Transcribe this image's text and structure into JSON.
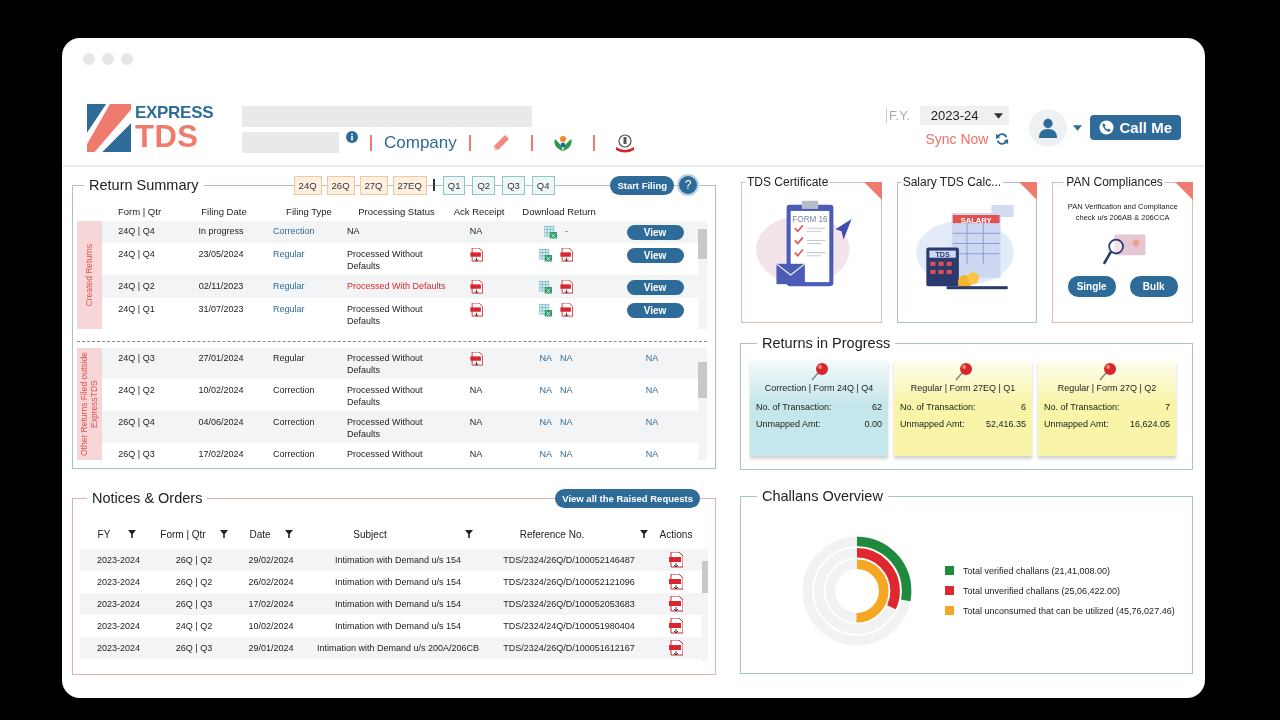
{
  "header": {
    "logo": {
      "top": "EXPRESS",
      "bottom": "TDS"
    },
    "company_link": "Company",
    "fy": {
      "label": "F.Y.",
      "value": "2023-24"
    },
    "sync": "Sync Now",
    "call": "Call Me"
  },
  "return_summary": {
    "title": "Return Summary",
    "forms": [
      {
        "label": "24Q",
        "selected": false
      },
      {
        "label": "26Q",
        "selected": false
      },
      {
        "label": "27Q",
        "selected": false
      },
      {
        "label": "27EQ",
        "selected": false
      }
    ],
    "quarters": [
      {
        "label": "Q1",
        "selected": false
      },
      {
        "label": "Q2",
        "selected": false
      },
      {
        "label": "Q3",
        "selected": false
      },
      {
        "label": "Q4",
        "selected": false
      }
    ],
    "start": "Start Filing",
    "help": "?",
    "columns": [
      "Form | Qtr",
      "Filing Date",
      "Filing Type",
      "Processing Status",
      "Ack Receipt",
      "Download Return"
    ],
    "groups": [
      {
        "kind": "created",
        "label": "Created Returns",
        "rows": [
          {
            "form": "24Q | Q4",
            "date": "In progress",
            "type": "Correction",
            "status": "NA",
            "alert": false,
            "ack": {
              "kind": "text",
              "text": "NA"
            },
            "download": [
              {
                "kind": "excel"
              },
              {
                "kind": "text",
                "text": "-"
              }
            ],
            "action": {
              "kind": "button",
              "text": "View"
            }
          },
          {
            "form": "24Q | Q4",
            "date": "23/05/2024",
            "type": "Regular",
            "status": "Processed Without Defaults",
            "alert": false,
            "ack": {
              "kind": "pdf"
            },
            "download": [
              {
                "kind": "excel"
              },
              {
                "kind": "pdf"
              }
            ],
            "action": {
              "kind": "button",
              "text": "View"
            }
          },
          {
            "form": "24Q | Q2",
            "date": "02/11/2023",
            "type": "Regular",
            "status": "Processed With Defaults",
            "alert": true,
            "ack": {
              "kind": "pdf"
            },
            "download": [
              {
                "kind": "excel"
              },
              {
                "kind": "pdf"
              }
            ],
            "action": {
              "kind": "button",
              "text": "View"
            }
          },
          {
            "form": "24Q | Q1",
            "date": "31/07/2023",
            "type": "Regular",
            "status": "Processed Without Defaults",
            "alert": false,
            "ack": {
              "kind": "pdf"
            },
            "download": [
              {
                "kind": "excel"
              },
              {
                "kind": "pdf"
              }
            ],
            "action": {
              "kind": "button",
              "text": "View"
            }
          }
        ]
      },
      {
        "kind": "external",
        "label": "Other Returns Filed outside ExpressTDS",
        "rows": [
          {
            "form": "24Q | Q3",
            "date": "27/01/2024",
            "type": "Regular",
            "status": "Processed Without Defaults",
            "alert": false,
            "ack": {
              "kind": "pdf"
            },
            "download": [
              {
                "kind": "text",
                "text": "NA"
              },
              {
                "kind": "text",
                "text": "NA"
              }
            ],
            "action": {
              "kind": "text",
              "text": "NA"
            }
          },
          {
            "form": "24Q | Q2",
            "date": "10/02/2024",
            "type": "Correction",
            "status": "Processed Without Defaults",
            "alert": false,
            "ack": {
              "kind": "text",
              "text": "NA"
            },
            "download": [
              {
                "kind": "text",
                "text": "NA"
              },
              {
                "kind": "text",
                "text": "NA"
              }
            ],
            "action": {
              "kind": "text",
              "text": "NA"
            }
          },
          {
            "form": "26Q | Q4",
            "date": "04/06/2024",
            "type": "Correction",
            "status": "Processed Without Defaults",
            "alert": false,
            "ack": {
              "kind": "text",
              "text": "NA"
            },
            "download": [
              {
                "kind": "text",
                "text": "NA"
              },
              {
                "kind": "text",
                "text": "NA"
              }
            ],
            "action": {
              "kind": "text",
              "text": "NA"
            }
          },
          {
            "form": "26Q | Q3",
            "date": "17/02/2024",
            "type": "Correction",
            "status": "Processed Without",
            "alert": false,
            "ack": {
              "kind": "text",
              "text": "NA"
            },
            "download": [
              {
                "kind": "text",
                "text": "NA"
              },
              {
                "kind": "text",
                "text": "NA"
              }
            ],
            "action": {
              "kind": "text",
              "text": "NA"
            }
          }
        ]
      }
    ]
  },
  "notices": {
    "title": "Notices & Orders",
    "button": "View all the Raised Requests",
    "columns": [
      {
        "label": "FY",
        "filter": true
      },
      {
        "label": "Form | Qtr",
        "filter": true
      },
      {
        "label": "Date",
        "filter": true
      },
      {
        "label": "Subject",
        "filter": true
      },
      {
        "label": "Reference No.",
        "filter": true
      },
      {
        "label": "Actions",
        "filter": false
      }
    ],
    "rows": [
      {
        "fy": "2023-2024",
        "form": "26Q | Q2",
        "date": "29/02/2024",
        "subject": "Intimation with Demand u/s 154",
        "reference": "TDS/2324/26Q/D/100052146487"
      },
      {
        "fy": "2023-2024",
        "form": "26Q | Q2",
        "date": "26/02/2024",
        "subject": "Intimation with Demand u/s 154",
        "reference": "TDS/2324/26Q/D/100052121096"
      },
      {
        "fy": "2023-2024",
        "form": "26Q | Q3",
        "date": "17/02/2024",
        "subject": "Intimation with Demand u/s 154",
        "reference": "TDS/2324/26Q/D/100052053683"
      },
      {
        "fy": "2023-2024",
        "form": "24Q | Q2",
        "date": "10/02/2024",
        "subject": "Intimation with Demand u/s 154",
        "reference": "TDS/2324/24Q/D/100051980404"
      },
      {
        "fy": "2023-2024",
        "form": "26Q | Q3",
        "date": "29/01/2024",
        "subject": "Intimation with Demand u/s 200A/206CB",
        "reference": "TDS/2324/26Q/D/100051612167"
      }
    ]
  },
  "tools": [
    {
      "kind": "certificate",
      "title": "TDS Certificate",
      "art_text": [
        "FORM 16"
      ]
    },
    {
      "kind": "salary",
      "title": "Salary TDS Calc...",
      "art_text": [
        "SALARY",
        "TDS"
      ]
    },
    {
      "kind": "pan",
      "title": "PAN Compliances",
      "description": "PAN Verification and Compliance check u/s 206AB & 206CCA",
      "buttons": [
        "Single",
        "Bulk"
      ]
    }
  ],
  "progress": {
    "title": "Returns in Progress",
    "cards": [
      {
        "kind": "correction",
        "title": "Correction | Form 24Q | Q4",
        "rows": [
          {
            "label": "No. of Transaction:",
            "value": "62"
          },
          {
            "label": "Unmapped Amt:",
            "value": "0.00"
          }
        ]
      },
      {
        "kind": "regular",
        "title": "Regular | Form 27EQ | Q1",
        "rows": [
          {
            "label": "No. of Transaction:",
            "value": "6"
          },
          {
            "label": "Unmapped Amt:",
            "value": "52,416.35"
          }
        ]
      },
      {
        "kind": "regular",
        "title": "Regular | Form 27Q | Q2",
        "rows": [
          {
            "label": "No. of Transaction:",
            "value": "7"
          },
          {
            "label": "Unmapped Amt:",
            "value": "16,624.05"
          }
        ]
      }
    ]
  },
  "challans": {
    "title": "Challans Overview",
    "legend": [
      {
        "label": "Total verified challans (21,41,008.00)",
        "color": "#1e8a3e"
      },
      {
        "label": "Total unverified challans (25,06,422.00)",
        "color": "#e0262e"
      },
      {
        "label": "Total unconsumed that can be utilized (45,76,027.46)",
        "color": "#f5a623"
      }
    ]
  }
}
